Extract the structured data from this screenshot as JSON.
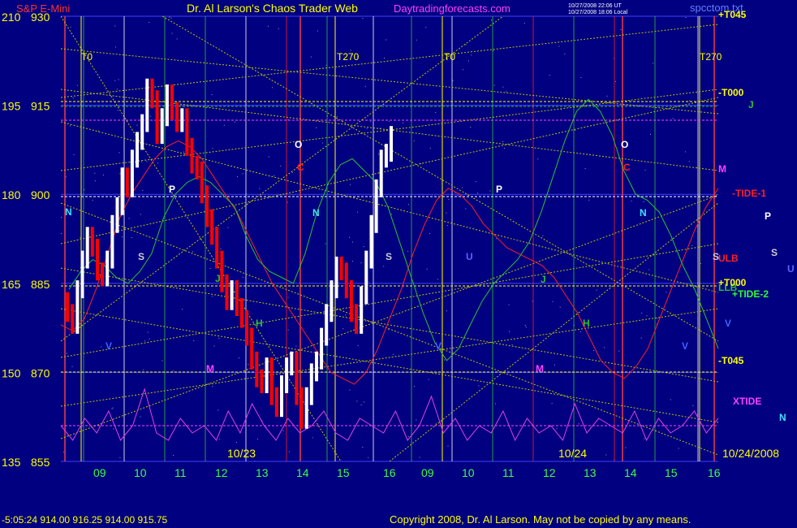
{
  "header": {
    "symbol": "S&P E-Mini",
    "title": "Dr. Al Larson's Chaos Trader Web",
    "site": "Daytradingforecasts.com",
    "timestamp_line1": "10/27/2008 22:06 UT",
    "timestamp_line2": "10/27/2008 18:06 Local",
    "file": "spcctom.txt"
  },
  "footer": {
    "status": "-5:05:24  914.00 916.25 914.00 915.75",
    "copyright": "Copyright 2008, Dr. Al Larson. May not be copied by any means."
  },
  "colors": {
    "background": "#000080",
    "price_up": "#ffffff",
    "price_down": "#ff0000",
    "tide": "#ff2020",
    "green_line": "#30c030",
    "xtide": "#e040e0",
    "yellow": "#ffff00"
  },
  "chart_data": {
    "type": "line",
    "y_left_labels": [
      "210",
      "195",
      "180",
      "165",
      "150",
      "135"
    ],
    "y_right_labels": [
      "930",
      "915",
      "900",
      "885",
      "870",
      "855"
    ],
    "ylim": [
      855,
      930
    ],
    "x_hour_labels": [
      "09",
      "10",
      "11",
      "12",
      "13",
      "14",
      "15",
      "16",
      "09",
      "10",
      "11",
      "12",
      "13",
      "14",
      "15",
      "16"
    ],
    "date_labels": [
      "10/23",
      "10/24",
      "10/24/2008"
    ],
    "markers": [
      "T0",
      "T270",
      "T0",
      "T270"
    ],
    "right_labels": [
      {
        "text": "+T045",
        "color": "#ffff00"
      },
      {
        "text": "-T000",
        "color": "#ffff00"
      },
      {
        "text": "J",
        "color": "#30c030"
      },
      {
        "text": "M",
        "color": "#ff40ff"
      },
      {
        "text": "-TIDE-1",
        "color": "#ff2020"
      },
      {
        "text": "P",
        "color": "#ffffff"
      },
      {
        "text": "ULB",
        "color": "#ff2020"
      },
      {
        "text": "S",
        "color": "#cccccc"
      },
      {
        "text": "U",
        "color": "#6060ff"
      },
      {
        "text": "LLB",
        "color": "#30c030"
      },
      {
        "text": "+T000",
        "color": "#ffff00"
      },
      {
        "text": "+TIDE-2",
        "color": "#30ff30"
      },
      {
        "text": "V",
        "color": "#4060ff"
      },
      {
        "text": "-T045",
        "color": "#ffff00"
      },
      {
        "text": "XTIDE",
        "color": "#ff40ff"
      },
      {
        "text": "N",
        "color": "#40e0ff"
      }
    ],
    "in_chart_labels": [
      "N",
      "V",
      "M",
      "P",
      "S",
      "J",
      "H",
      "O",
      "C",
      "N",
      "S",
      "U",
      "V",
      "P",
      "J",
      "M",
      "H",
      "O",
      "C",
      "N",
      "V",
      "S"
    ],
    "price_series": {
      "name": "",
      "values": [
        882,
        880,
        878,
        884,
        889,
        893,
        891,
        887,
        886,
        889,
        895,
        898,
        903,
        901,
        906,
        909,
        912,
        918,
        916,
        910,
        913,
        917,
        914,
        912,
        913,
        908,
        905,
        904,
        900,
        896,
        893,
        889,
        885,
        882,
        884,
        881,
        879,
        876,
        872,
        869,
        868,
        871,
        866,
        864,
        868,
        871,
        872,
        866,
        862,
        866,
        870,
        872,
        876,
        880,
        884,
        888,
        887,
        884,
        880,
        878,
        883,
        889,
        895,
        901,
        906,
        907,
        910
      ]
    },
    "tide_series": {
      "name": "",
      "values": [
        878,
        877,
        879,
        884,
        890,
        896,
        900,
        903,
        906,
        908,
        909,
        908,
        906,
        903,
        900,
        897,
        893,
        889,
        885,
        882,
        879,
        876,
        873,
        870,
        869,
        868,
        870,
        874,
        879,
        884,
        890,
        895,
        899,
        901,
        900,
        898,
        895,
        893,
        891,
        890,
        889,
        888,
        886,
        883,
        880,
        876,
        872,
        870,
        869,
        871,
        874,
        879,
        884,
        889,
        894,
        898,
        901
      ]
    },
    "green_series": {
      "name": "",
      "values": [
        884,
        887,
        889,
        888,
        886,
        885,
        887,
        890,
        896,
        900,
        902,
        903,
        902,
        900,
        898,
        893,
        889,
        887,
        886,
        885,
        890,
        897,
        902,
        905,
        906,
        904,
        902,
        898,
        892,
        886,
        880,
        875,
        872,
        874,
        878,
        882,
        885,
        887,
        889,
        892,
        897,
        903,
        909,
        914,
        916,
        914,
        910,
        904,
        900,
        899,
        897,
        893,
        888,
        884,
        879,
        874
      ]
    },
    "xtide_series": {
      "name": "",
      "values": [
        0.4,
        0.2,
        0.5,
        0.3,
        0.6,
        0.2,
        0.4,
        0.9,
        0.3,
        0.2,
        0.5,
        0.3,
        0.4,
        0.2,
        0.6,
        0.3,
        0.7,
        0.4,
        0.2,
        0.5,
        0.3,
        0.4,
        0.6,
        0.3,
        0.2,
        0.5,
        0.4,
        0.3,
        0.6,
        0.2,
        0.4,
        0.8,
        0.3,
        0.5,
        0.2,
        0.4,
        0.3,
        0.6,
        0.2,
        0.5,
        0.3,
        0.4,
        0.2,
        0.7,
        0.3,
        0.5,
        0.4,
        0.3,
        0.6,
        0.2,
        0.5,
        0.3,
        0.4,
        0.6,
        0.3,
        0.5
      ]
    }
  }
}
